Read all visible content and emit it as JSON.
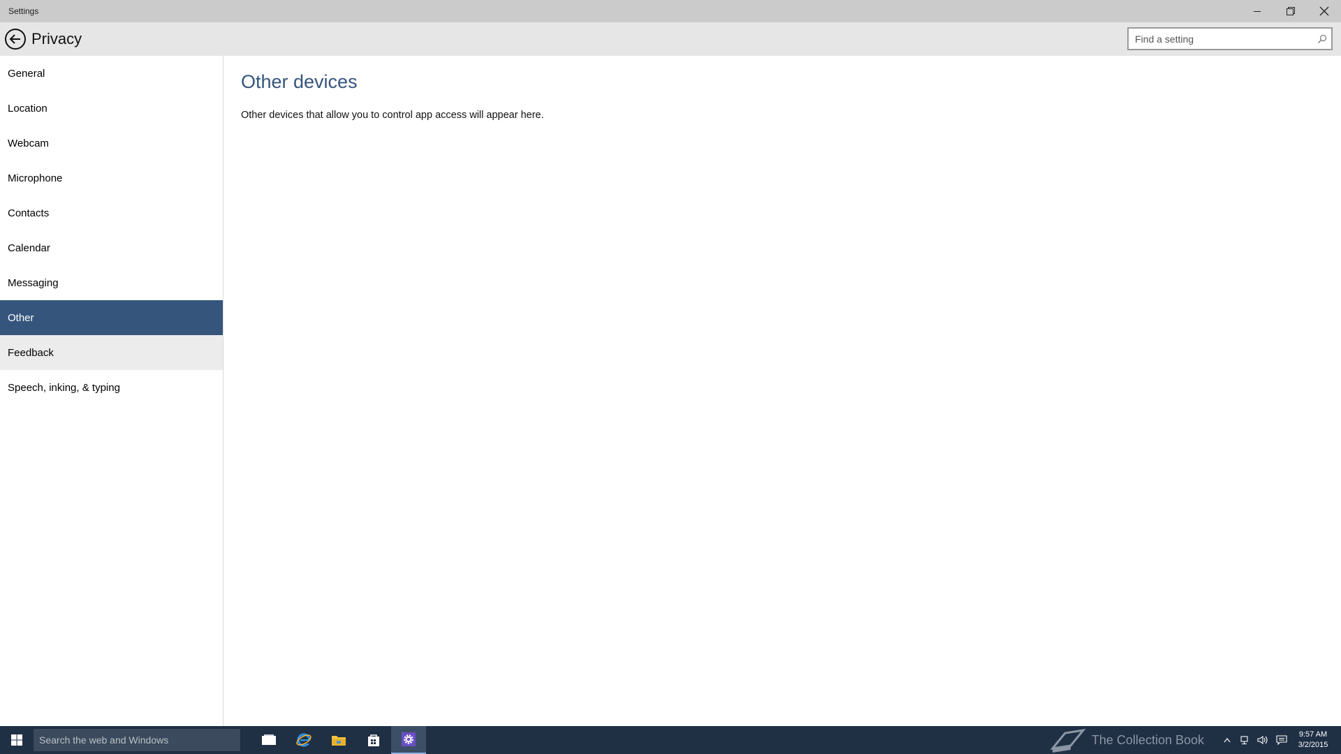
{
  "window": {
    "title": "Settings"
  },
  "header": {
    "title": "Privacy",
    "search_placeholder": "Find a setting"
  },
  "sidebar": {
    "items": [
      {
        "label": "General"
      },
      {
        "label": "Location"
      },
      {
        "label": "Webcam"
      },
      {
        "label": "Microphone"
      },
      {
        "label": "Contacts"
      },
      {
        "label": "Calendar"
      },
      {
        "label": "Messaging"
      },
      {
        "label": "Other"
      },
      {
        "label": "Feedback"
      },
      {
        "label": "Speech, inking, & typing"
      }
    ],
    "selected": "Other",
    "hovered": "Feedback"
  },
  "main": {
    "heading": "Other devices",
    "description": "Other devices that allow you to control app access will appear here."
  },
  "taskbar": {
    "search_placeholder": "Search the web and Windows",
    "watermark": "The Collection Book",
    "time": "9:57 AM",
    "date": "3/2/2015"
  },
  "colors": {
    "accent": "#36557d",
    "titlebar": "#cbcbcb",
    "header": "#e6e6e6",
    "taskbar": "#1f2f44"
  }
}
